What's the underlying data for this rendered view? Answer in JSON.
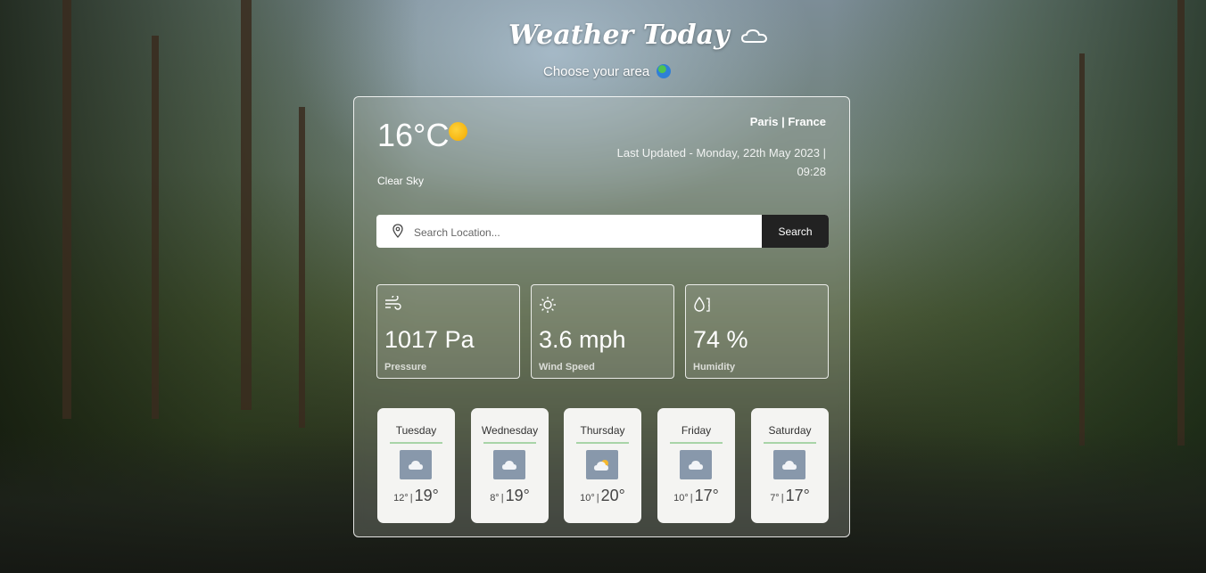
{
  "header": {
    "title": "Weather Today",
    "subtitle": "Choose your area"
  },
  "current": {
    "temperature": "16°C",
    "condition": "Clear Sky",
    "location": "Paris | France",
    "last_updated": "Last Updated - Monday, 22th May 2023 | 09:28",
    "icon": "sun-icon"
  },
  "search": {
    "placeholder": "Search Location...",
    "value": "",
    "button_label": "Search"
  },
  "stats": [
    {
      "value": "1017 Pa",
      "label": "Pressure",
      "icon": "wind-icon"
    },
    {
      "value": "3.6 mph",
      "label": "Wind Speed",
      "icon": "sun-outline-icon"
    },
    {
      "value": "74 %",
      "label": "Humidity",
      "icon": "droplet-icon"
    }
  ],
  "forecast": [
    {
      "day": "Tuesday",
      "low": "12°",
      "high": "19°",
      "icon": "cloud-icon"
    },
    {
      "day": "Wednesday",
      "low": "8°",
      "high": "19°",
      "icon": "cloud-icon"
    },
    {
      "day": "Thursday",
      "low": "10°",
      "high": "20°",
      "icon": "partly-cloudy-icon"
    },
    {
      "day": "Friday",
      "low": "10°",
      "high": "17°",
      "icon": "cloud-icon"
    },
    {
      "day": "Saturday",
      "low": "7°",
      "high": "17°",
      "icon": "cloud-icon"
    }
  ],
  "separator": "|",
  "colors": {
    "search_button": "#222222",
    "day_card": "#f4f4f2",
    "day_underline": "#a8d4a8",
    "sun": "#f2a900"
  }
}
